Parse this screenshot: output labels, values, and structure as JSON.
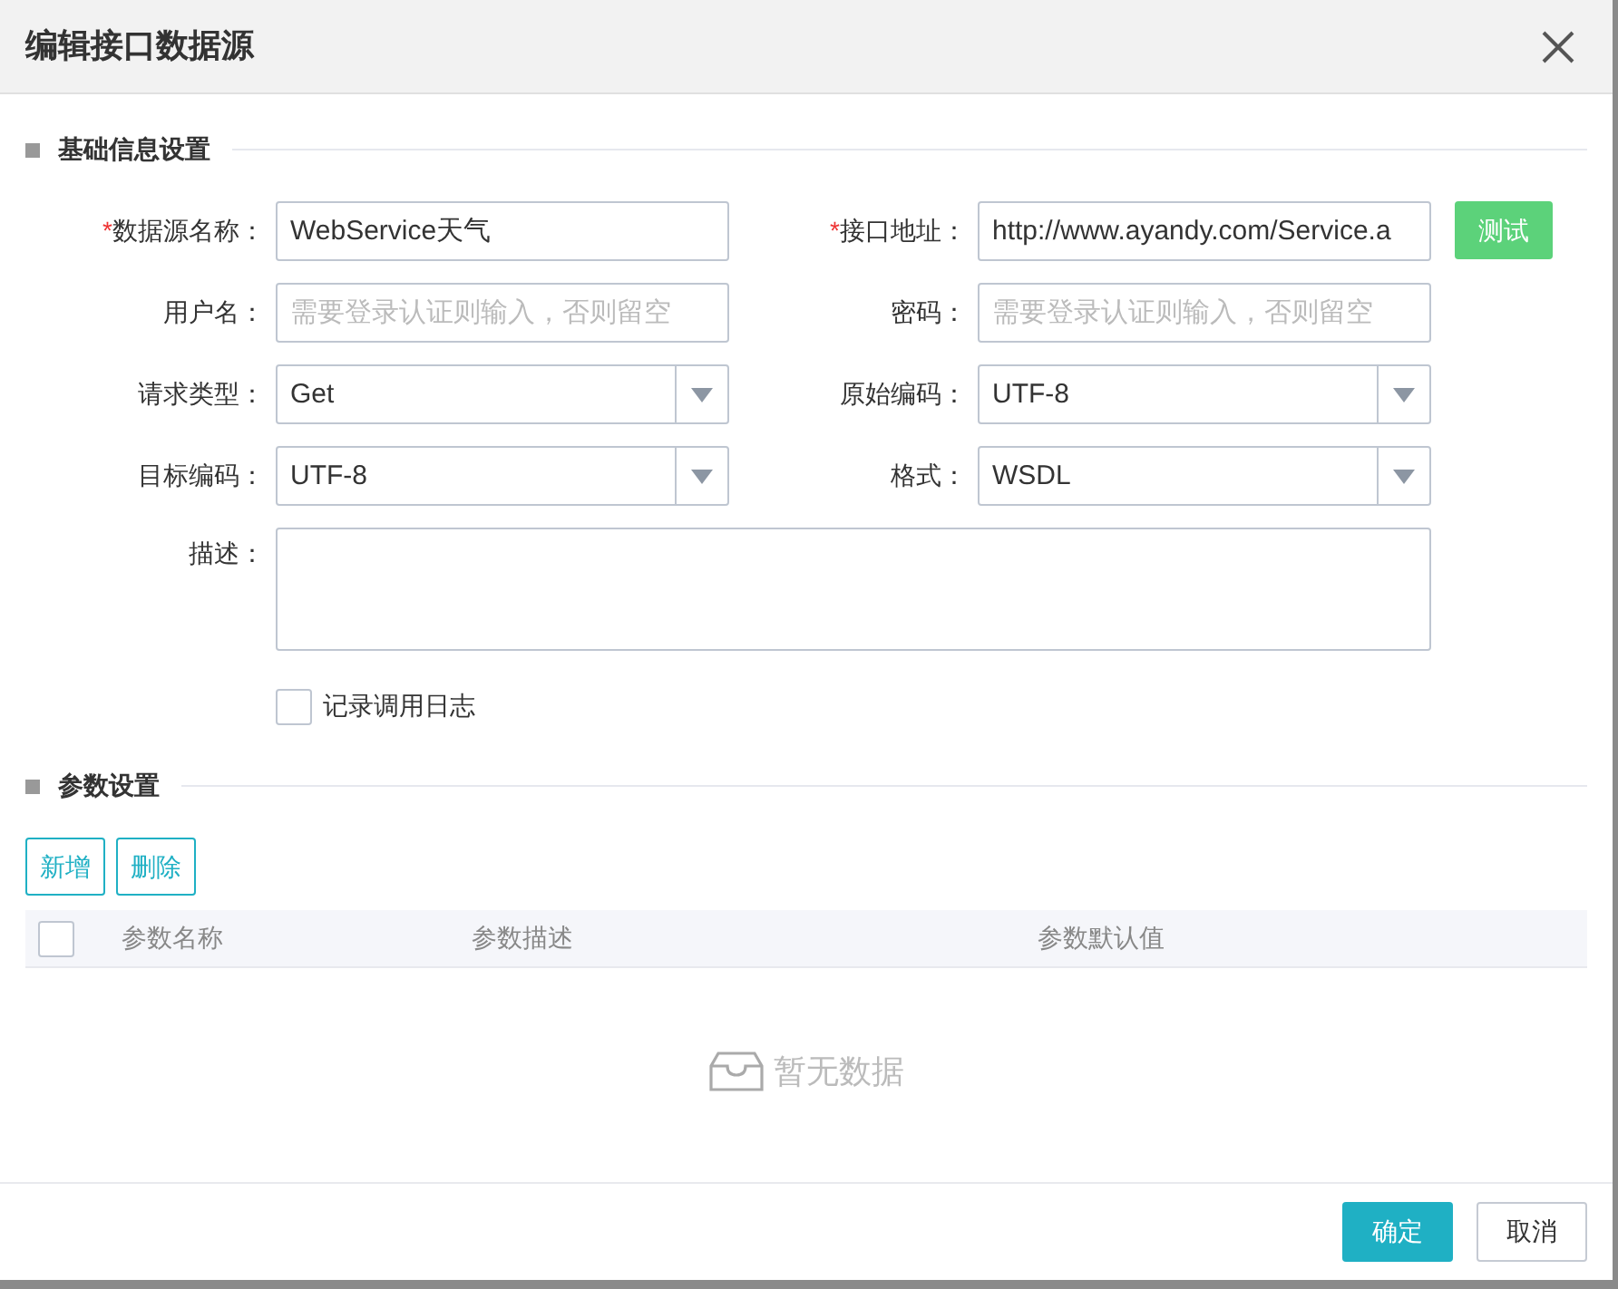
{
  "dialog": {
    "title": "编辑接口数据源"
  },
  "basic_section": {
    "title": "基础信息设置",
    "fields": [
      {
        "kind": "text",
        "label": "数据源名称：",
        "required_mark": "*",
        "value": "WebService天气"
      },
      {
        "kind": "text",
        "label": "接口地址：",
        "required_mark": "*",
        "value": "http://www.ayandy.com/Service.a",
        "action": "测试"
      },
      {
        "kind": "text",
        "label": "用户名：",
        "placeholder": "需要登录认证则输入，否则留空"
      },
      {
        "kind": "text",
        "label": "密码：",
        "placeholder": "需要登录认证则输入，否则留空"
      },
      {
        "kind": "select",
        "label": "请求类型：",
        "value": "Get"
      },
      {
        "kind": "select",
        "label": "原始编码：",
        "value": "UTF-8"
      },
      {
        "kind": "select",
        "label": "目标编码：",
        "value": "UTF-8"
      },
      {
        "kind": "select",
        "label": "格式：",
        "value": "WSDL"
      },
      {
        "kind": "textarea",
        "label": "描述："
      }
    ],
    "log_checkbox": {
      "label": "记录调用日志",
      "checked": false
    }
  },
  "param_section": {
    "title": "参数设置",
    "buttons": [
      "新增",
      "删除"
    ],
    "table": {
      "select_all_checked": false,
      "columns": [
        "参数名称",
        "参数描述",
        "参数默认值"
      ],
      "empty_text": "暂无数据"
    }
  },
  "footer": {
    "buttons": [
      {
        "label": "确定",
        "primary": true
      },
      {
        "label": "取消",
        "primary": false
      }
    ]
  }
}
